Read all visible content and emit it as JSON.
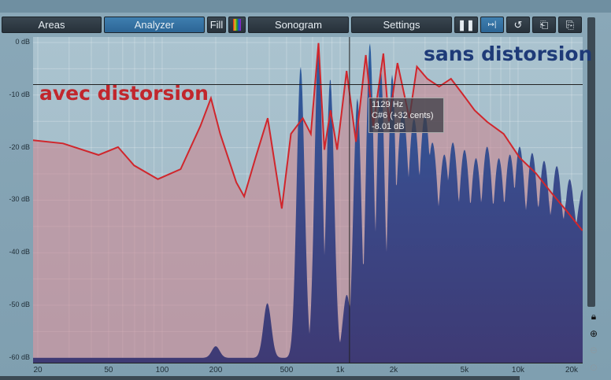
{
  "toolbar": {
    "areas": "Areas",
    "analyzer": "Analyzer",
    "fill": "Fill",
    "sonogram": "Sonogram",
    "settings": "Settings"
  },
  "annotations": {
    "red_label": "avec distorsion",
    "blue_label": "sans distorsion"
  },
  "tooltip": {
    "freq": "1129 Hz",
    "note": "C#6 (+32 cents)",
    "level": "-8.01 dB"
  },
  "colors": {
    "red": "#d0262c",
    "blue_text": "#1e3a78",
    "red_text": "#c1272d",
    "blue_fill": "#3c3a78",
    "blue_top": "#275a9c"
  },
  "chart_data": {
    "type": "area",
    "x_scale": "log",
    "xlim": [
      18,
      23000
    ],
    "ylim": [
      -61,
      1
    ],
    "ylabel_ticks": [
      "0 dB",
      "-10 dB",
      "-20 dB",
      "-30 dB",
      "-40 dB",
      "-50 dB",
      "-60 dB"
    ],
    "y_ticks": [
      0,
      -10,
      -20,
      -30,
      -40,
      -50,
      -60
    ],
    "x_ticks": [
      20,
      50,
      100,
      200,
      500,
      1000,
      2000,
      5000,
      10000,
      20000
    ],
    "x_tick_labels": [
      "20",
      "50",
      "100",
      "200",
      "500",
      "1k",
      "2k",
      "5k",
      "10k",
      "20k"
    ],
    "cursor": {
      "freq": 1129,
      "db": -8
    },
    "series": [
      {
        "name": "avec distorsion",
        "points": [
          [
            18.8,
            -18.6
          ],
          [
            27.7,
            -19.2
          ],
          [
            43.9,
            -21.4
          ],
          [
            56.5,
            -19.9
          ],
          [
            69.5,
            -23.4
          ],
          [
            94.6,
            -26
          ],
          [
            127,
            -24.1
          ],
          [
            164,
            -15.9
          ],
          [
            188,
            -10.6
          ],
          [
            212,
            -17.4
          ],
          [
            261,
            -26.6
          ],
          [
            289,
            -29.3
          ],
          [
            335,
            -21.9
          ],
          [
            392,
            -14.4
          ],
          [
            470,
            -31.6
          ],
          [
            529,
            -17.4
          ],
          [
            617,
            -14.4
          ],
          [
            685,
            -17.4
          ],
          [
            756,
            -0.1
          ],
          [
            816,
            -20.4
          ],
          [
            883,
            -12.9
          ],
          [
            962,
            -20.4
          ],
          [
            1088,
            -5.4
          ],
          [
            1228,
            -18.9
          ],
          [
            1395,
            -2.4
          ],
          [
            1534,
            -15.9
          ],
          [
            1751,
            -2.1
          ],
          [
            1880,
            -15
          ],
          [
            2100,
            -3.9
          ],
          [
            2450,
            -14.4
          ],
          [
            2700,
            -4.6
          ],
          [
            3090,
            -6.9
          ],
          [
            3600,
            -8.4
          ],
          [
            4200,
            -6.9
          ],
          [
            4900,
            -9.9
          ],
          [
            5700,
            -12.9
          ],
          [
            6700,
            -15.1
          ],
          [
            8300,
            -17.4
          ],
          [
            10200,
            -21.9
          ],
          [
            12600,
            -24.9
          ],
          [
            15400,
            -28.6
          ],
          [
            19000,
            -32.3
          ],
          [
            23000,
            -35.8
          ]
        ]
      },
      {
        "name": "sans distorsion",
        "peaks": [
          [
            200,
            -57.8
          ],
          [
            390,
            -49.6
          ],
          [
            600,
            -4.6
          ],
          [
            756,
            -0.1
          ],
          [
            880,
            -6.9
          ],
          [
            1090,
            -48
          ],
          [
            1250,
            -10.6
          ],
          [
            1470,
            -0.1
          ],
          [
            1690,
            -4.6
          ],
          [
            1960,
            -6.1
          ],
          [
            2250,
            -13
          ],
          [
            2600,
            -14.5
          ],
          [
            3000,
            -13.8
          ],
          [
            3300,
            -19
          ],
          [
            3850,
            -21.3
          ],
          [
            4300,
            -19
          ],
          [
            5000,
            -20.4
          ],
          [
            5800,
            -22
          ],
          [
            6700,
            -19.8
          ],
          [
            7800,
            -22
          ],
          [
            9000,
            -21.3
          ],
          [
            10200,
            -19.8
          ],
          [
            12000,
            -21
          ],
          [
            14000,
            -22.5
          ],
          [
            16500,
            -23.5
          ],
          [
            19500,
            -26
          ],
          [
            23000,
            -28
          ]
        ]
      }
    ]
  }
}
